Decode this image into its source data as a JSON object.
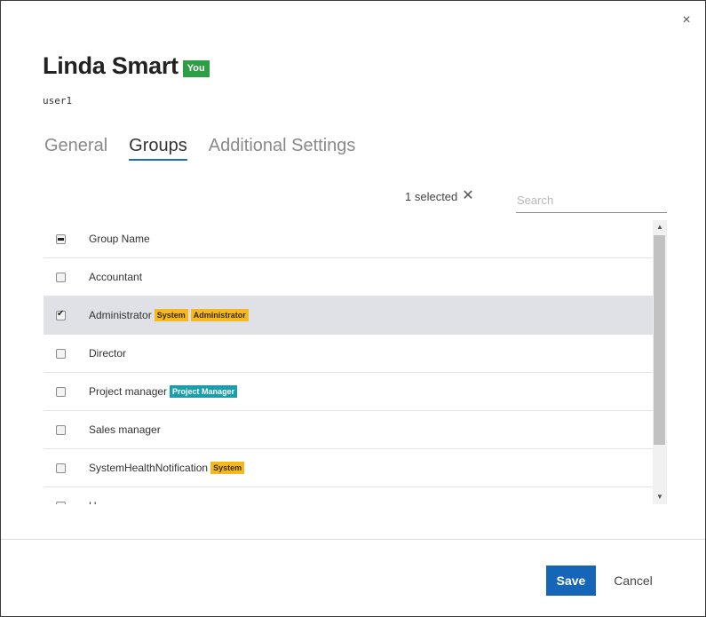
{
  "dialog": {
    "close_icon": "×",
    "user_name": "Linda Smart",
    "you_badge": "You",
    "login": "user1"
  },
  "tabs": [
    {
      "label": "General",
      "active": false
    },
    {
      "label": "Groups",
      "active": true
    },
    {
      "label": "Additional Settings",
      "active": false
    }
  ],
  "toolbar": {
    "selected_label": "1 selected",
    "clear_icon": "✕",
    "search_placeholder": "Search"
  },
  "table": {
    "header": "Group Name",
    "rows": [
      {
        "name": "Accountant",
        "checked": false,
        "badges": []
      },
      {
        "name": "Administrator",
        "checked": true,
        "badges": [
          {
            "text": "System",
            "color": "#f5b81e"
          },
          {
            "text": "Administrator",
            "color": "#f5b81e"
          }
        ]
      },
      {
        "name": "Director",
        "checked": false,
        "badges": []
      },
      {
        "name": "Project manager",
        "checked": false,
        "badges": [
          {
            "text": "Project Manager",
            "color": "#1a9eab"
          }
        ]
      },
      {
        "name": "Sales manager",
        "checked": false,
        "badges": []
      },
      {
        "name": "SystemHealthNotification",
        "checked": false,
        "badges": [
          {
            "text": "System",
            "color": "#f5b81e"
          }
        ]
      },
      {
        "name": "U",
        "checked": false,
        "badges": []
      }
    ]
  },
  "scrollbar": {
    "up_icon": "▲",
    "down_icon": "▼"
  },
  "footer": {
    "save_label": "Save",
    "cancel_label": "Cancel"
  },
  "colors": {
    "primary": "#1565b8",
    "you_badge": "#2e9e45",
    "system_badge": "#f5b81e",
    "role_badge": "#1a9eab",
    "selected_row": "#dfe1e6"
  }
}
